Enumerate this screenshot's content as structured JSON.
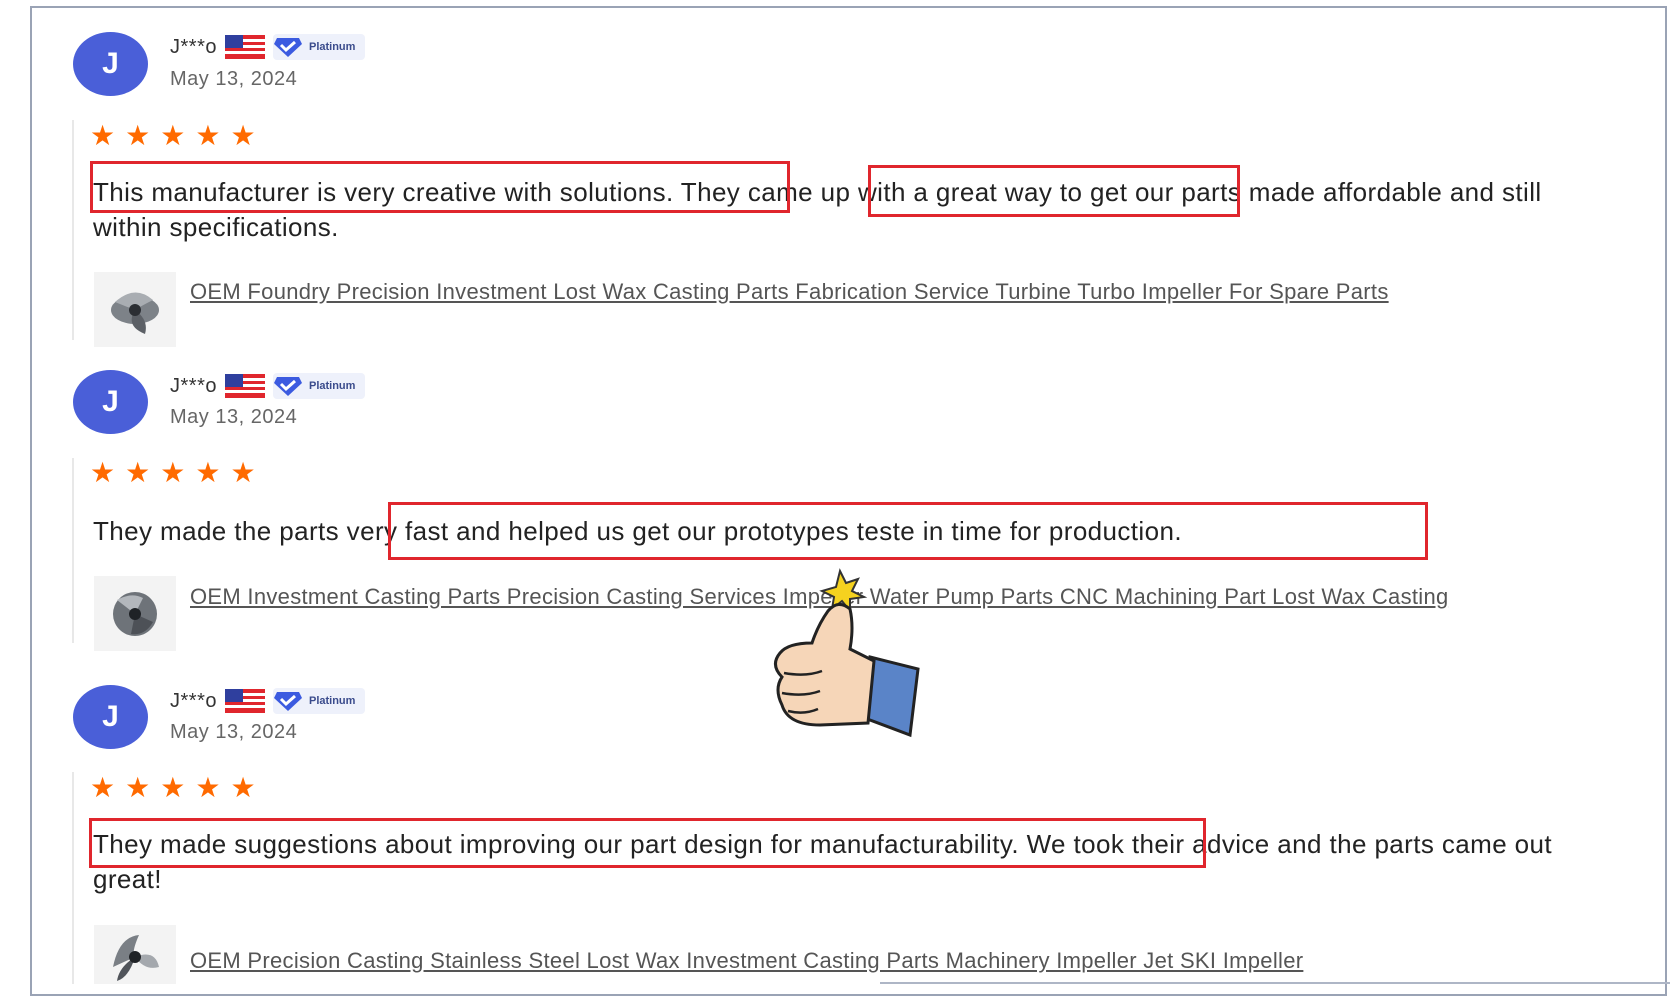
{
  "reviews": [
    {
      "avatar_letter": "J",
      "username": "J***o",
      "badge": "Platinum",
      "date": "May 13, 2024",
      "rating": 5,
      "text": "This manufacturer is very creative with solutions. They came up with a great way to get our parts made affordable and still within specifications.",
      "product": "OEM Foundry Precision Investment Lost Wax Casting Parts Fabrication Service Turbine Turbo Impeller For Spare Parts"
    },
    {
      "avatar_letter": "J",
      "username": "J***o",
      "badge": "Platinum",
      "date": "May 13, 2024",
      "rating": 5,
      "text": "They made the parts very fast and helped us get our prototypes teste in time for production.",
      "product": "OEM Investment Casting Parts Precision Casting Services Impeller Water Pump Parts CNC Machining Part Lost Wax Casting"
    },
    {
      "avatar_letter": "J",
      "username": "J***o",
      "badge": "Platinum",
      "date": "May 13, 2024",
      "rating": 5,
      "text": "They made suggestions about improving our part design for manufacturability. We took their advice and the parts came out great!",
      "product": "OEM Precision Casting Stainless Steel Lost Wax Investment Casting Parts Machinery Impeller Jet SKI Impeller"
    }
  ],
  "colors": {
    "avatar": "#4a5fd8",
    "star": "#ff6a00",
    "highlight_box": "#e0262d"
  },
  "icons": [
    "us-flag-icon",
    "verified-diamond-icon",
    "star-icon",
    "impeller-thumbnail",
    "thumbs-up-icon"
  ]
}
